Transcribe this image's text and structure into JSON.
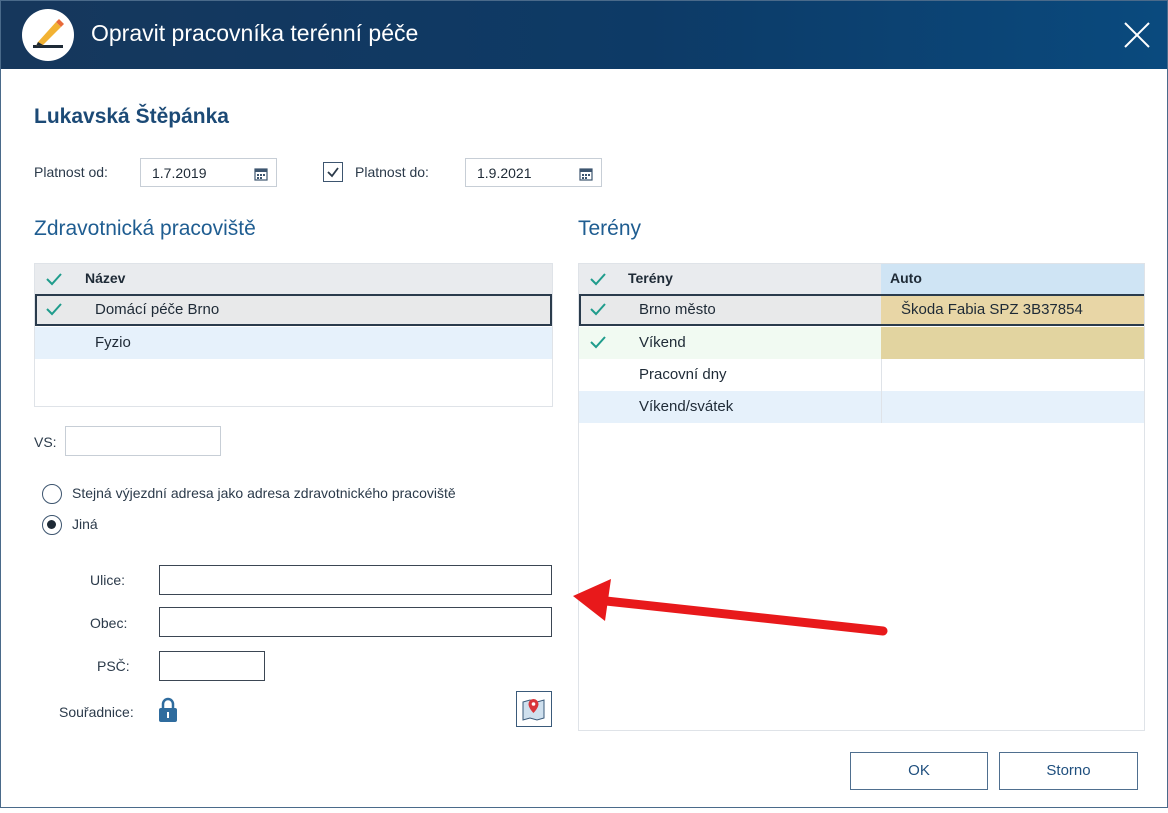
{
  "window": {
    "title": "Opravit pracovníka terénní péče",
    "close_icon": "close-icon",
    "app_icon": "pencil-edit-icon"
  },
  "person": {
    "name": "Lukavská Štěpánka"
  },
  "validity": {
    "from_label": "Platnost od:",
    "from_value": "1.7.2019",
    "to_checked": true,
    "to_label": "Platnost do:",
    "to_value": "1.9.2021"
  },
  "workplaces": {
    "title": "Zdravotnická pracoviště",
    "header": "Název",
    "rows": [
      {
        "name": "Domácí péče Brno",
        "checked": true,
        "selected": true
      },
      {
        "name": "Fyzio",
        "checked": false,
        "selected": false
      }
    ]
  },
  "vs": {
    "label": "VS:",
    "value": ""
  },
  "address": {
    "option_same": "Stejná výjezdní adresa jako adresa zdravotnického pracoviště",
    "option_other": "Jiná",
    "selected": "other",
    "street_label": "Ulice:",
    "street_value": "",
    "city_label": "Obec:",
    "city_value": "",
    "zip_label": "PSČ:",
    "zip_value": "",
    "coords_label": "Souřadnice:"
  },
  "terrains": {
    "title": "Terény",
    "header_name": "Terény",
    "header_car": "Auto",
    "rows": [
      {
        "name": "Brno město",
        "car": "Škoda Fabia SPZ 3B37854",
        "checked": true
      },
      {
        "name": "Víkend",
        "car": "",
        "checked": true
      },
      {
        "name": "Pracovní dny",
        "car": "",
        "checked": false
      },
      {
        "name": "Víkend/svátek",
        "car": "",
        "checked": false
      }
    ]
  },
  "buttons": {
    "ok": "OK",
    "cancel": "Storno"
  },
  "colors": {
    "title_bar": "#0d3a66",
    "accent": "#1f5d91",
    "check": "#1f9c8c",
    "car_cell": "#e8d6a6"
  }
}
